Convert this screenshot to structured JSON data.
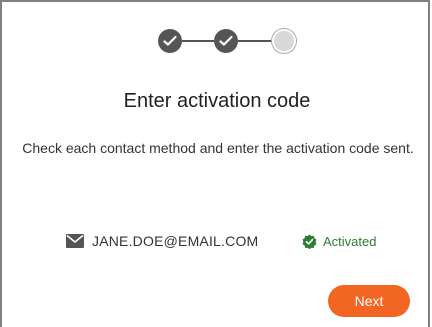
{
  "stepper": {
    "steps": [
      {
        "state": "completed",
        "icon": "check-icon"
      },
      {
        "state": "completed",
        "icon": "check-icon"
      },
      {
        "state": "current",
        "icon": ""
      }
    ],
    "completed_color": "#555555"
  },
  "title": "Enter activation code",
  "description": "Check each contact method and enter the activation code sent.",
  "contact": {
    "icon": "envelope-icon",
    "email": "JANE.DOE@EMAIL.COM",
    "status_icon": "verified-badge-icon",
    "status_label": "Activated",
    "status_color": "#2e7d32"
  },
  "actions": {
    "next_label": "Next",
    "accent_color": "#f26522"
  }
}
